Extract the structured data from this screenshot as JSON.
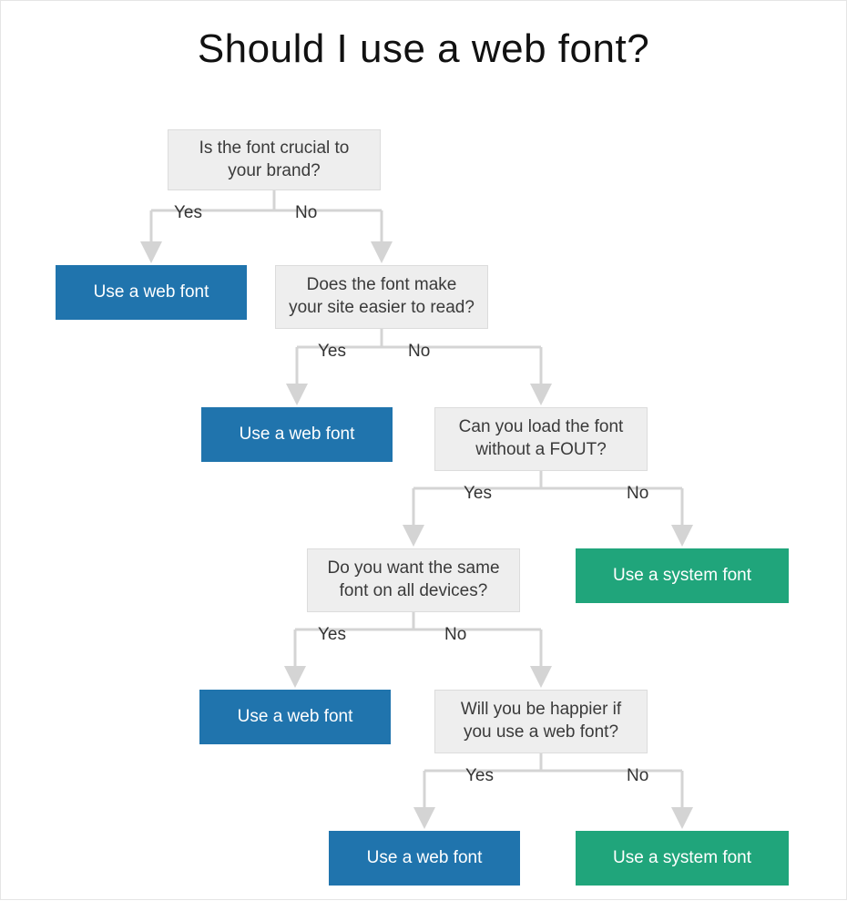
{
  "title": "Should I use a web font?",
  "labels": {
    "yes": "Yes",
    "no": "No"
  },
  "terminals": {
    "web_font": "Use a web font",
    "system_font": "Use a system font"
  },
  "nodes": {
    "q1": {
      "text": "Is the font crucial to your brand?",
      "type": "question",
      "yes_label": "Yes",
      "no_label": "No",
      "yes_target": "t1",
      "no_target": "q2"
    },
    "q2": {
      "text": "Does the font make your site easier to read?",
      "type": "question",
      "yes_label": "Yes",
      "no_label": "No",
      "yes_target": "t2",
      "no_target": "q3"
    },
    "q3": {
      "text": "Can you load the font without a FOUT?",
      "type": "question",
      "yes_label": "Yes",
      "no_label": "No",
      "yes_target": "q4",
      "no_target": "t3"
    },
    "q4": {
      "text": "Do you want the same font on all devices?",
      "type": "question",
      "yes_label": "Yes",
      "no_label": "No",
      "yes_target": "t4",
      "no_target": "q5"
    },
    "q5": {
      "text": "Will you be happier if you use a web font?",
      "type": "question",
      "yes_label": "Yes",
      "no_label": "No",
      "yes_target": "t5",
      "no_target": "t6"
    },
    "t1": {
      "text": "Use a web font",
      "type": "terminal",
      "color": "blue"
    },
    "t2": {
      "text": "Use a web font",
      "type": "terminal",
      "color": "blue"
    },
    "t3": {
      "text": "Use a system font",
      "type": "terminal",
      "color": "green"
    },
    "t4": {
      "text": "Use a web font",
      "type": "terminal",
      "color": "blue"
    },
    "t5": {
      "text": "Use a web font",
      "type": "terminal",
      "color": "blue"
    },
    "t6": {
      "text": "Use a system font",
      "type": "terminal",
      "color": "green"
    }
  },
  "colors": {
    "question_bg": "#eeeeee",
    "question_border": "#dcdcdc",
    "blue": "#2074ad",
    "green": "#20a57b",
    "arrow": "#d4d4d4"
  }
}
